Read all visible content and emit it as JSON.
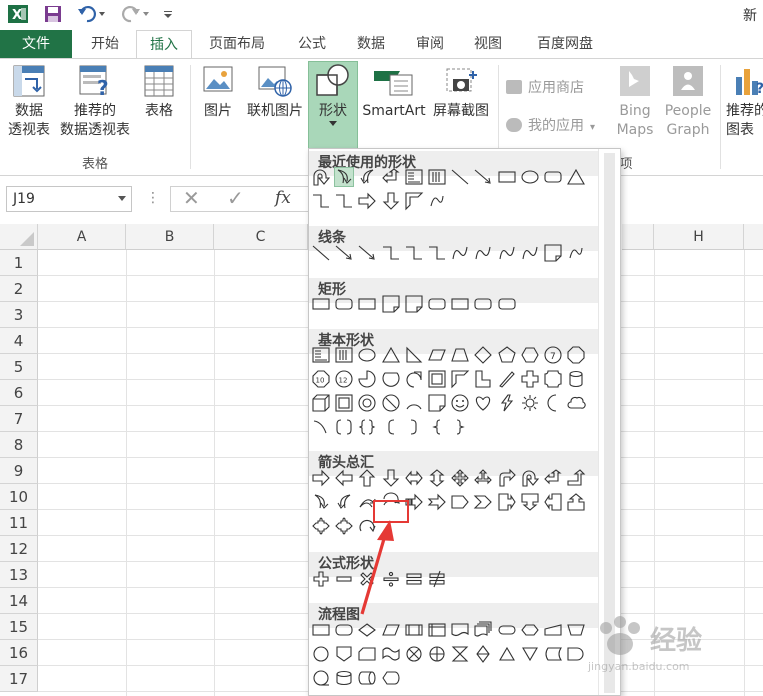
{
  "titlebar": {
    "title": "新"
  },
  "tabs": [
    "文件",
    "开始",
    "插入",
    "页面布局",
    "公式",
    "数据",
    "审阅",
    "视图",
    "百度网盘"
  ],
  "ribbon": {
    "pivot": "数据\n透视表",
    "recommended_pivot": "推荐的\n数据透视表",
    "table": "表格",
    "picture": "图片",
    "online_picture": "联机图片",
    "shapes": "形状",
    "smartart": "SmartArt",
    "screenshot": "屏幕截图",
    "app_store": "应用商店",
    "my_apps": "我的应用",
    "bing_maps": "Bing\nMaps",
    "people_graph": "People\nGraph",
    "recommended_chart": "推荐的\n图表",
    "group_tables": "表格",
    "group_addins_tail": "项"
  },
  "formula_bar": {
    "name_box": "J19",
    "fx": "fx"
  },
  "grid": {
    "columns": [
      "A",
      "B",
      "C",
      "H"
    ],
    "rows": [
      "1",
      "2",
      "3",
      "4",
      "5",
      "6",
      "7",
      "8",
      "9",
      "10",
      "11",
      "12",
      "13",
      "14",
      "15",
      "16",
      "17"
    ]
  },
  "shapes_menu": {
    "sections": [
      "最近使用的形状",
      "线条",
      "矩形",
      "基本形状",
      "箭头总汇",
      "公式形状",
      "流程图"
    ]
  },
  "watermark": {
    "text": "经验",
    "sub": "jingyan.baidu.com"
  }
}
